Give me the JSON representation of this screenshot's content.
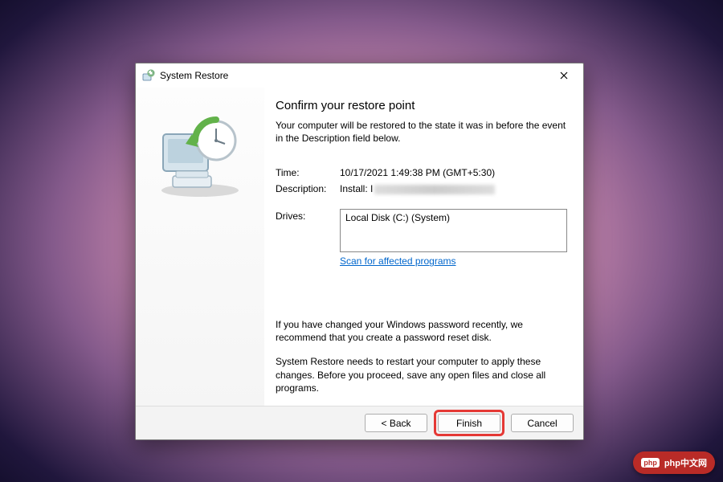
{
  "window": {
    "title": "System Restore"
  },
  "heading": "Confirm your restore point",
  "intro": "Your computer will be restored to the state it was in before the event in the Description field below.",
  "fields": {
    "time_label": "Time:",
    "time_value": "10/17/2021 1:49:38 PM (GMT+5:30)",
    "description_label": "Description:",
    "description_value": "Install: I",
    "drives_label": "Drives:",
    "drives_value": "Local Disk (C:) (System)"
  },
  "scan_link": "Scan for affected programs",
  "note1": "If you have changed your Windows password recently, we recommend that you create a password reset disk.",
  "note2": "System Restore needs to restart your computer to apply these changes. Before you proceed, save any open files and close all programs.",
  "buttons": {
    "back": "< Back",
    "finish": "Finish",
    "cancel": "Cancel"
  },
  "badge": {
    "text": "php中文网"
  }
}
